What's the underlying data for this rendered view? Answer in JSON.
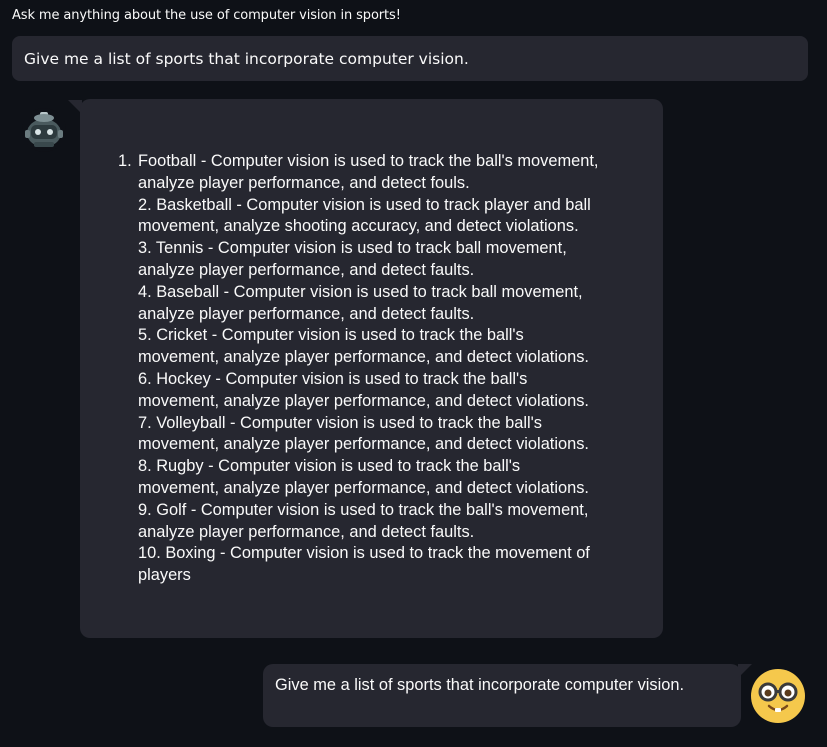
{
  "header": {
    "prompt_label": "Ask me anything about the use of computer vision in sports!"
  },
  "input": {
    "value": "Give me a list of sports that incorporate computer vision."
  },
  "chat": {
    "bot_avatar_icon": "robot-avatar-icon",
    "user_avatar_icon": "nerd-face-avatar-icon",
    "bot_message": {
      "first_number": "1.",
      "lines": [
        "Football - Computer vision is used to track the ball's movement,",
        "analyze player performance, and detect fouls.",
        "2. Basketball - Computer vision is used to track player and ball",
        "movement, analyze shooting accuracy, and detect violations.",
        "3. Tennis - Computer vision is used to track ball movement,",
        "analyze player performance, and detect faults.",
        "4. Baseball - Computer vision is used to track ball movement,",
        "analyze player performance, and detect faults.",
        "5. Cricket - Computer vision is used to track the ball's",
        "movement, analyze player performance, and detect violations.",
        "6. Hockey - Computer vision is used to track the ball's",
        "movement, analyze player performance, and detect violations.",
        "7. Volleyball - Computer vision is used to track the ball's",
        "movement, analyze player performance, and detect violations.",
        "8. Rugby - Computer vision is used to track the ball's",
        "movement, analyze player performance, and detect violations.",
        "9. Golf - Computer vision is used to track the ball's movement,",
        "analyze player performance, and detect faults.",
        "10. Boxing - Computer vision is used to track the movement of",
        "players"
      ]
    },
    "user_message": "Give me a list of sports that incorporate computer vision."
  },
  "colors": {
    "background": "#0e1117",
    "bubble": "#262730",
    "text": "#fafafa",
    "user_avatar": "#f5c84c"
  }
}
